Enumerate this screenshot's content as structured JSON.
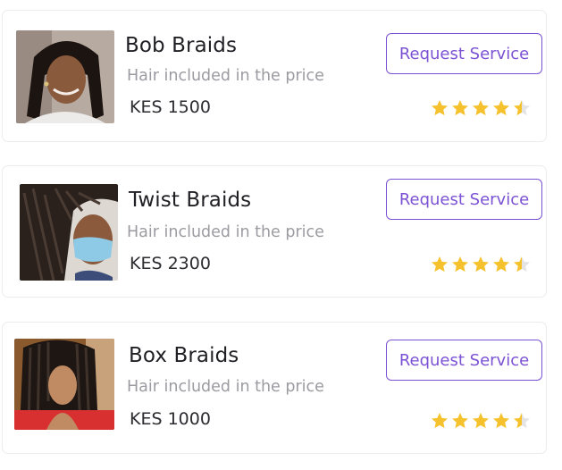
{
  "services": [
    {
      "title": "Bob Braids",
      "subtitle": "Hair included in the price",
      "price": "KES 1500",
      "button_label": "Request Service",
      "rating": 4.5,
      "image": "bob-braids-photo"
    },
    {
      "title": "Twist Braids",
      "subtitle": "Hair included in the price",
      "price": "KES 2300",
      "button_label": "Request Service",
      "rating": 4.5,
      "image": "twist-braids-photo"
    },
    {
      "title": "Box Braids",
      "subtitle": "Hair included in the price",
      "price": "KES 1000",
      "button_label": "Request Service",
      "rating": 4.5,
      "image": "box-braids-photo"
    }
  ],
  "colors": {
    "accent": "#7b52d4",
    "star_filled": "#f5c22e",
    "star_empty": "#e4e4e4"
  }
}
